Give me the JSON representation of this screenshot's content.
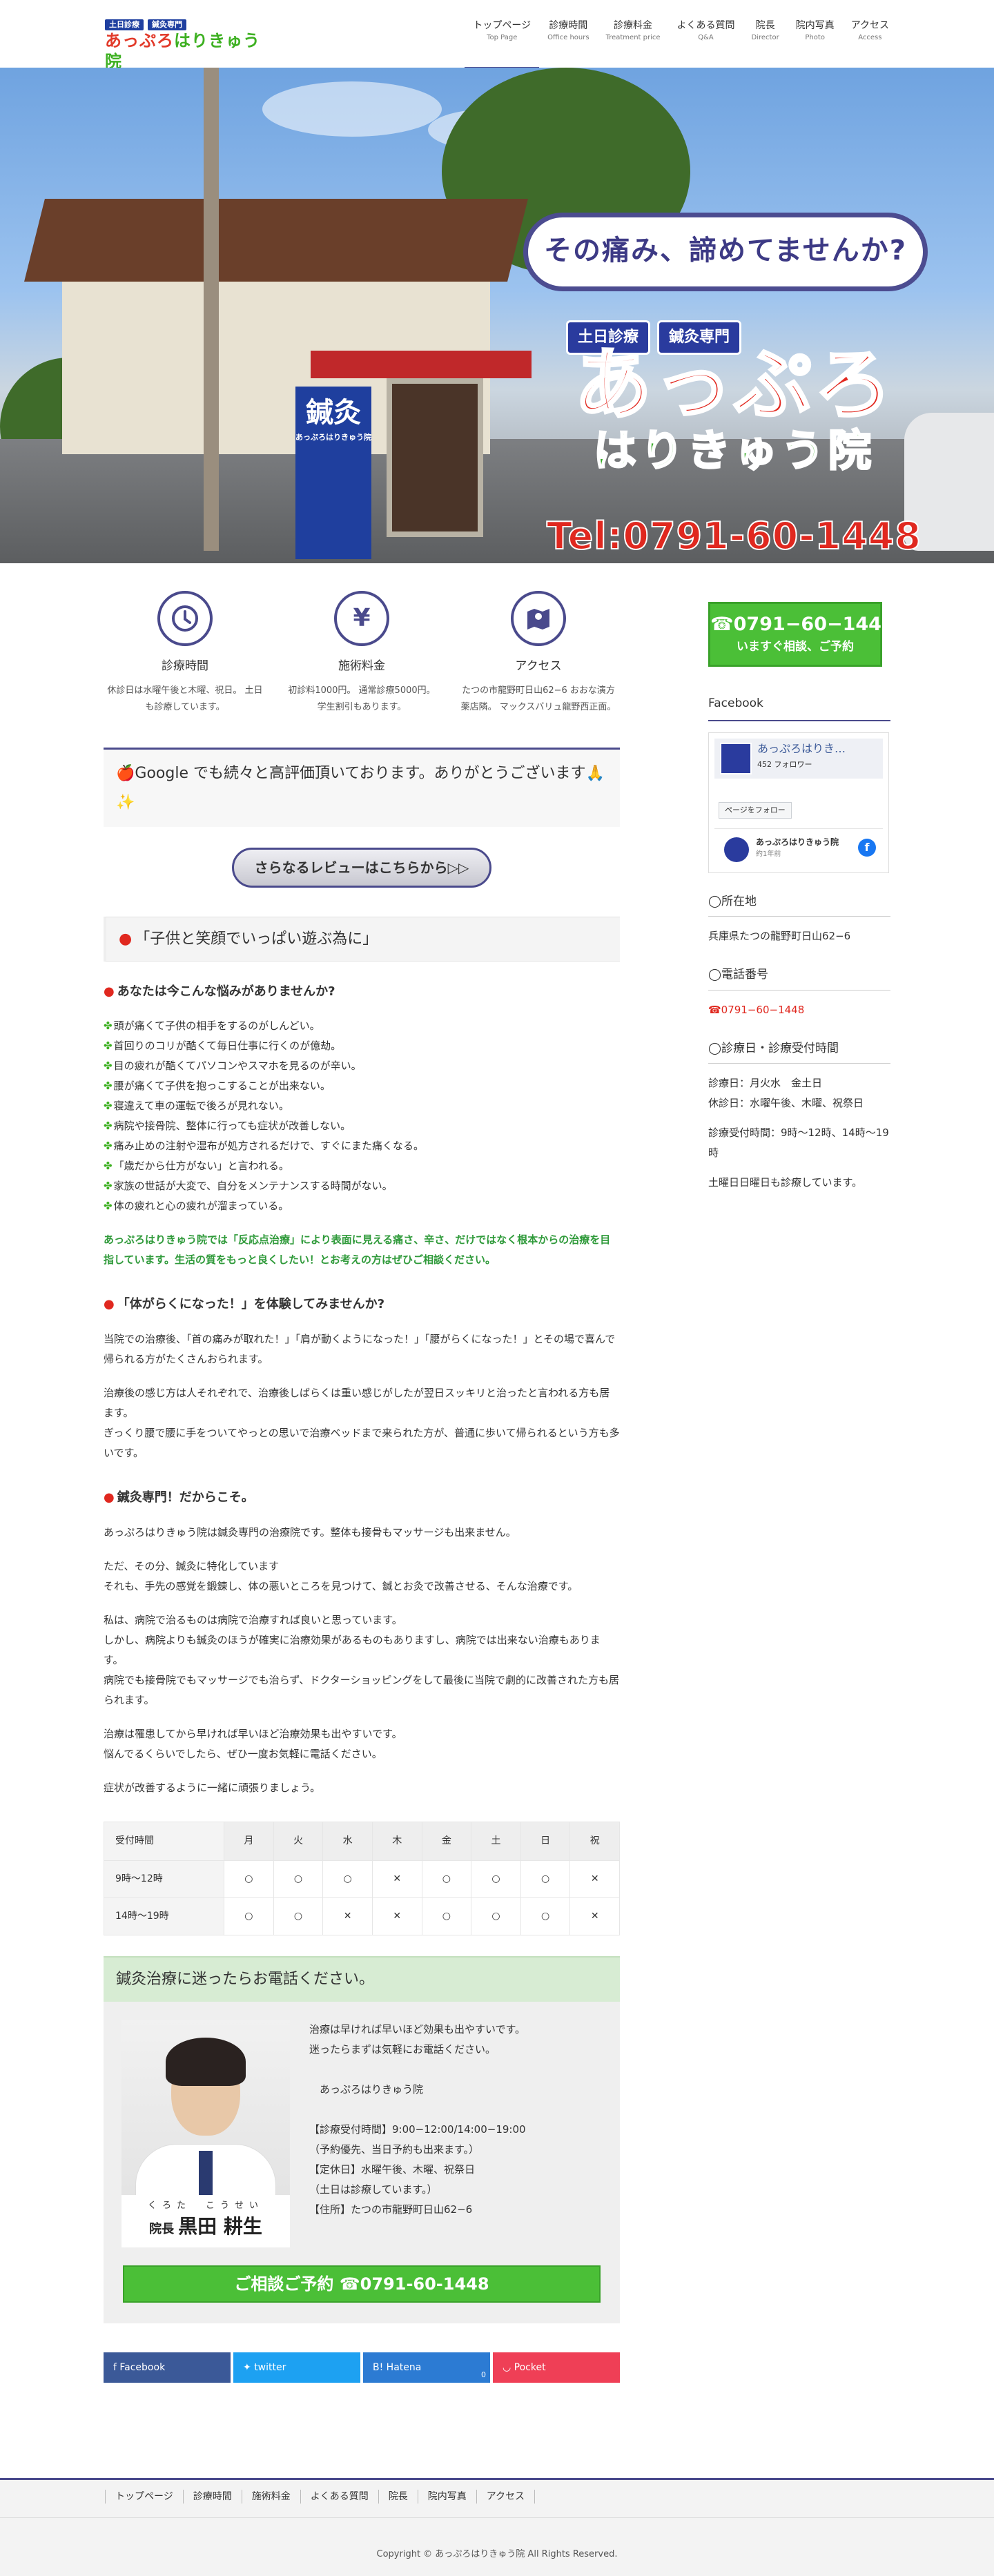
{
  "header": {
    "logo_tags": [
      "土日診療",
      "鍼灸専門"
    ],
    "logo_text_a": "あっぷろ",
    "logo_text_b": "はりきゅう院",
    "nav": [
      {
        "ja": "トップページ",
        "en": "Top Page"
      },
      {
        "ja": "診療時間",
        "en": "Office hours"
      },
      {
        "ja": "診療料金",
        "en": "Treatment price"
      },
      {
        "ja": "よくある質問",
        "en": "Q&A"
      },
      {
        "ja": "院長",
        "en": "Director"
      },
      {
        "ja": "院内写真",
        "en": "Photo"
      },
      {
        "ja": "アクセス",
        "en": "Access"
      }
    ]
  },
  "hero": {
    "bubble": "その痛み、諦めてませんか?",
    "tags": [
      "土日診療",
      "鍼灸専門"
    ],
    "title_a": "あっぷろ",
    "title_b": "はりきゅう院",
    "tel": "Tel:0791-60-1448",
    "banner_big": "鍼灸",
    "banner_small": "あっぷろはりきゅう院"
  },
  "features": [
    {
      "icon": "clock-icon",
      "title": "診療時間",
      "text": "休診日は水曜午後と木曜、祝日。 土日も診療しています。"
    },
    {
      "icon": "yen-icon",
      "title": "施術料金",
      "text": "初診料1000円。 通常診療5000円。 学生割引もあります。"
    },
    {
      "icon": "map-icon",
      "title": "アクセス",
      "text": "たつの市龍野町日山62−6 おおな演方薬店隣。 マックスバリュ龍野西正面。"
    }
  ],
  "notice": "🍎Google でも続々と高評価頂いております。ありがとうございます🙏✨",
  "review_button": "さらなるレビューはこちらから▷▷",
  "section1": {
    "heading": "「子供と笑顔でいっぱい遊ぶ為に」",
    "sub": "あなたは今こんな悩みがありませんか?",
    "checks": [
      "頭が痛くて子供の相手をするのがしんどい。",
      "首回りのコリが酷くて毎日仕事に行くのが億劫。",
      "目の疲れが酷くてパソコンやスマホを見るのが辛い。",
      "腰が痛くて子供を抱っこすることが出来ない。",
      "寝違えて車の運転で後ろが見れない。",
      "病院や接骨院、整体に行っても症状が改善しない。",
      "痛み止めの注射や湿布が処方されるだけで、すぐにまた痛くなる。",
      "「歳だから仕方がない」と言われる。",
      "家族の世話が大変で、自分をメンテナンスする時間がない。",
      "体の疲れと心の疲れが溜まっている。"
    ],
    "green": "あっぷろはりきゅう院では「反応点治療」により表面に見える痛さ、辛さ、だけではなく根本からの治療を目指しています。生活の質をもっと良くしたい！とお考えの方はぜひご相談ください。"
  },
  "section2": {
    "sub": "「体がらくになった！」を体験してみませんか?",
    "p1": "当院での治療後、「首の痛みが取れた！」「肩が動くようになった！」「腰がらくになった！」とその場で喜んで帰られる方がたくさんおられます。",
    "p2": "治療後の感じ方は人それぞれで、治療後しばらくは重い感じがしたが翌日スッキリと治ったと言われる方も居ます。\nぎっくり腰で腰に手をついてやっとの思いで治療ベッドまで来られた方が、普通に歩いて帰られるという方も多いです。"
  },
  "section3": {
    "sub": "鍼灸専門！だからこそ。",
    "p1": "あっぷろはりきゅう院は鍼灸専門の治療院です。整体も接骨もマッサージも出来ません。",
    "p2": "ただ、その分、鍼灸に特化しています\nそれも、手先の感覚を鍛錬し、体の悪いところを見つけて、鍼とお灸で改善させる、そんな治療です。",
    "p3": "私は、病院で治るものは病院で治療すれば良いと思っています。\nしかし、病院よりも鍼灸のほうが確実に治療効果があるものもありますし、病院では出来ない治療もあります。\n病院でも接骨院でもマッサージでも治らず、ドクターショッピングをして最後に当院で劇的に改善された方も居られます。",
    "p4": "治療は罹患してから早ければ早いほど治療効果も出やすいです。\n悩んでるくらいでしたら、ぜひ一度お気軽に電話ください。",
    "p5": "症状が改善するように一緒に頑張りましょう。"
  },
  "schedule": {
    "headers": [
      "受付時間",
      "月",
      "火",
      "水",
      "木",
      "金",
      "土",
      "日",
      "祝"
    ],
    "rows": [
      [
        "9時〜12時",
        "○",
        "○",
        "○",
        "✕",
        "○",
        "○",
        "○",
        "✕"
      ],
      [
        "14時〜19時",
        "○",
        "○",
        "✕",
        "✕",
        "○",
        "○",
        "○",
        "✕"
      ]
    ]
  },
  "callbox": {
    "heading": "鍼灸治療に迷ったらお電話ください。",
    "kana": "くろた　こうせい",
    "title": "院長",
    "name": "黒田 耕生",
    "text": "治療は早ければ早いほど効果も出やすいです。\n迷ったらまずは気軽にお電話ください。\n\n　あっぷろはりきゅう院\n\n【診療受付時間】9:00−12:00/14:00−19:00\n（予約優先、当日予約も出来ます。）\n【定休日】水曜午後、木曜、祝祭日\n（土日は診療しています。）\n【住所】たつの市龍野町日山62−6",
    "button": "ご相談ご予約 ☎0791-60-1448"
  },
  "shares": [
    {
      "label": "Facebook",
      "color": "#3b5998",
      "icon": "facebook-icon",
      "count": ""
    },
    {
      "label": "twitter",
      "color": "#1da1f2",
      "icon": "twitter-icon",
      "count": ""
    },
    {
      "label": "Hatena",
      "color": "#2c7bd3",
      "icon": "hatena-icon",
      "count": "0"
    },
    {
      "label": "Pocket",
      "color": "#ef3f56",
      "icon": "pocket-icon",
      "count": ""
    }
  ],
  "sidebar": {
    "call_tel": "☎0791−60−1448",
    "call_sub": "いますぐ相談、ご予約",
    "fb_heading": "Facebook",
    "fb_name": "あっぷろはりき…",
    "fb_followers": "452 フォロワー",
    "fb_follow_btn": "ページをフォロー",
    "fb_post_name": "あっぷろはりきゅう院",
    "fb_post_time": "約1年前",
    "address_h": "◯所在地",
    "address": "兵庫県たつの龍野町日山62−6",
    "phone_h": "◯電話番号",
    "phone": "☎0791−60−1448",
    "hours_h": "◯診療日・診療受付時間",
    "hours": "診療日：月火水　金土日\n休診日：水曜午後、木曜、祝祭日",
    "hours2": "診療受付時間：9時〜12時、14時〜19時",
    "hours3": "土曜日日曜日も診療しています。"
  },
  "footer": {
    "nav": [
      "トップページ",
      "診療時間",
      "施術料金",
      "よくある質問",
      "院長",
      "院内写真",
      "アクセス"
    ],
    "copyright": "Copyright © あっぷろはりきゅう院 All Rights Reserved."
  },
  "colors": {
    "accent": "#4a4a8c",
    "green": "#4bbf37",
    "red": "#e0281f"
  }
}
